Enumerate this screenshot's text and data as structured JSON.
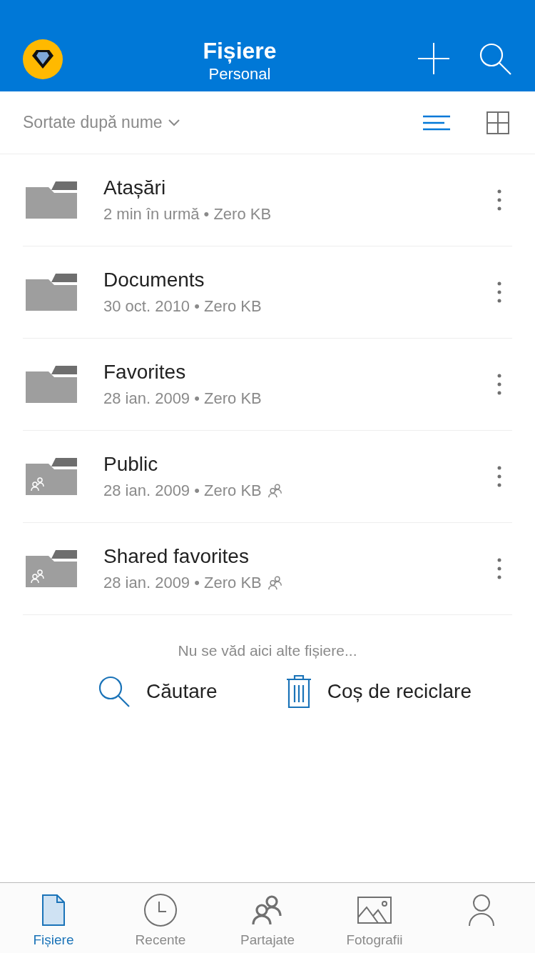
{
  "header": {
    "title": "Fișiere",
    "subtitle": "Personal"
  },
  "sort": {
    "label": "Sortate după nume"
  },
  "view_toggles": [
    {
      "kind": "list",
      "selected": true
    },
    {
      "kind": "grid",
      "selected": false
    }
  ],
  "items": [
    {
      "name": "Atașări",
      "meta": "2 min în urmă • Zero KB",
      "shared": false
    },
    {
      "name": "Documents",
      "meta": "30 oct. 2010 • Zero KB",
      "shared": false
    },
    {
      "name": "Favorites",
      "meta": "28 ian. 2009 • Zero KB",
      "shared": false
    },
    {
      "name": "Public",
      "meta": "28 ian. 2009 • Zero KB",
      "shared": true
    },
    {
      "name": "Shared favorites",
      "meta": "28 ian. 2009 • Zero KB",
      "shared": true
    }
  ],
  "footer": {
    "note": "Nu se văd aici alte fișiere...",
    "actions": [
      {
        "kind": "search",
        "label": "Căutare"
      },
      {
        "kind": "recycle",
        "label": "Coș de reciclare"
      }
    ]
  },
  "tabs": [
    {
      "kind": "files",
      "label": "Fișiere",
      "selected": true
    },
    {
      "kind": "recent",
      "label": "Recente",
      "selected": false
    },
    {
      "kind": "shared",
      "label": "Partajate",
      "selected": false
    },
    {
      "kind": "photos",
      "label": "Fotografii",
      "selected": false
    },
    {
      "kind": "account",
      "selected": false
    }
  ]
}
